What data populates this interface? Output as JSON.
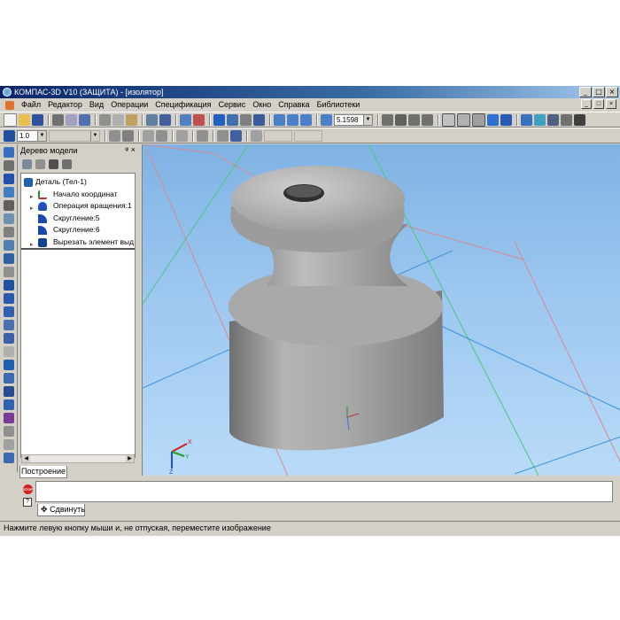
{
  "window": {
    "title": "КОМПАС-3D V10 (ЗАЩИТА) - [изолятор]",
    "buttons": [
      "_",
      "□",
      "×"
    ]
  },
  "menu": {
    "items": [
      "Файл",
      "Редактор",
      "Вид",
      "Операции",
      "Спецификация",
      "Сервис",
      "Окно",
      "Справка",
      "Библиотеки"
    ],
    "mdi_buttons": [
      "_",
      "□",
      "×"
    ]
  },
  "toolbar": {
    "zoom_value": "5.1598",
    "step_value": "1.0"
  },
  "tree_panel": {
    "title": "Дерево модели",
    "pin_close": "ᵠ ×",
    "items": [
      {
        "label": "Деталь (Тел-1)",
        "icon": "part-icon",
        "color": "#2060b0"
      },
      {
        "label": "Начало координат",
        "icon": "axes-icon",
        "color": "#808080"
      },
      {
        "label": "Операция вращения:1",
        "icon": "revolve-icon",
        "color": "#2050c0"
      },
      {
        "label": "Скругление:5",
        "icon": "fillet-icon",
        "color": "#1848b0"
      },
      {
        "label": "Скругление:6",
        "icon": "fillet-icon",
        "color": "#1848b0"
      },
      {
        "label": "Вырезать элемент выд",
        "icon": "cut-extrude-icon",
        "color": "#104090"
      }
    ],
    "tab_label": "Построение"
  },
  "command": {
    "stop_label": "STOP",
    "help_label": "?",
    "tab_label": "Сдвинуть",
    "tab_icon": "✥"
  },
  "status": {
    "text": "Нажмите левую кнопку мыши и, не отпуская, переместите изображение"
  },
  "viewport": {
    "background_top": "#7fb3e4",
    "background_bottom": "#b9dbf8",
    "part_color": "#9a9a9a",
    "axis_labels": {
      "x": "X",
      "y": "Y",
      "z": "Z"
    }
  }
}
